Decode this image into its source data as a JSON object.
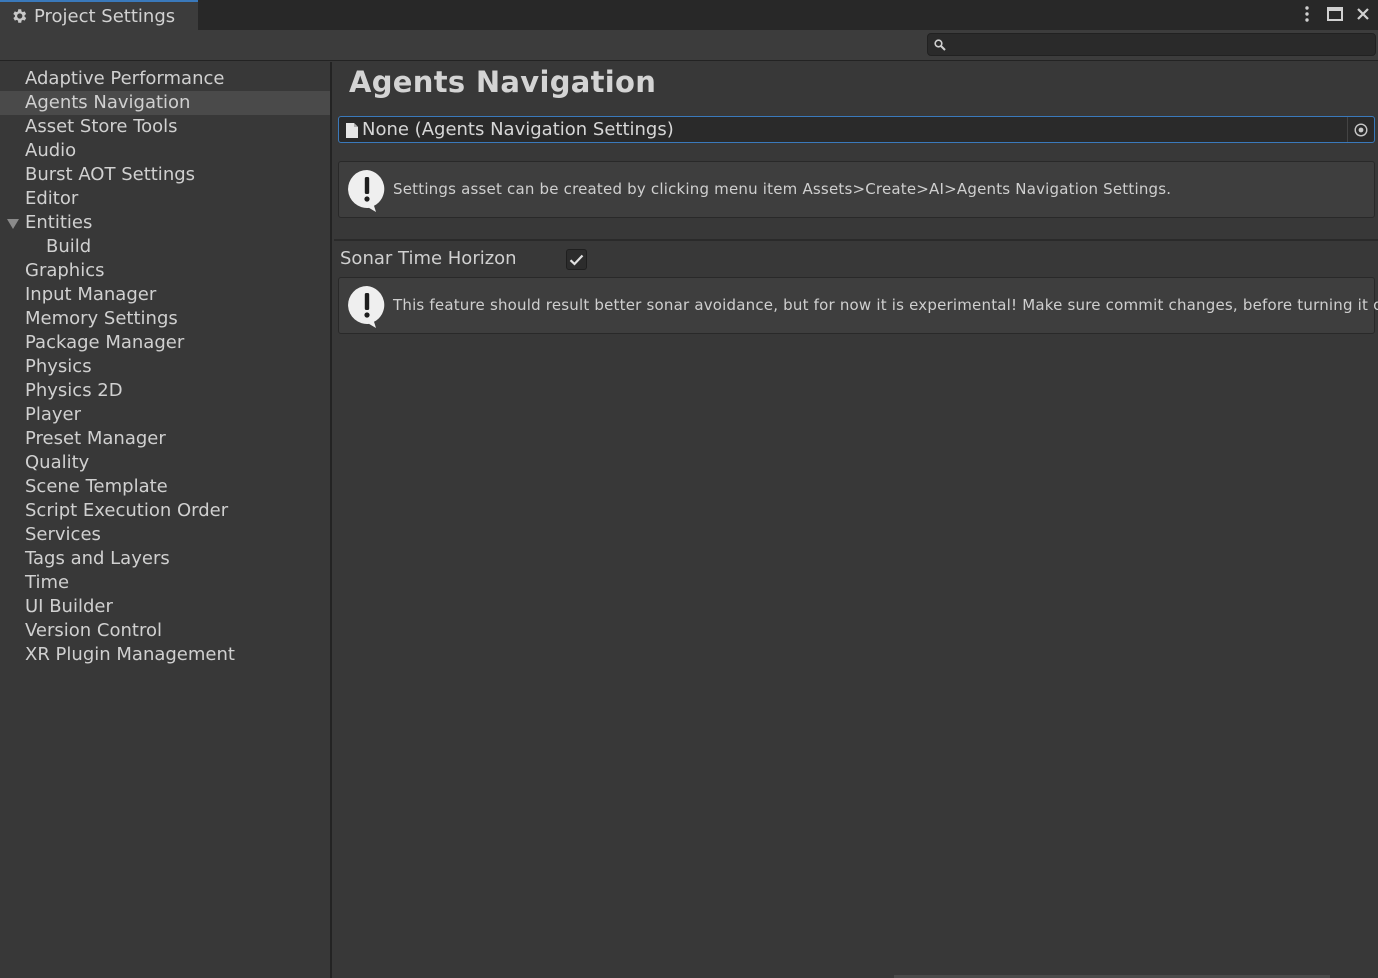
{
  "window": {
    "tab_title": "Project Settings",
    "tab_icon": "gear-icon",
    "controls": [
      "more-options-icon",
      "maximize-icon",
      "close-icon"
    ]
  },
  "search": {
    "icon": "search-icon",
    "value": "",
    "placeholder": ""
  },
  "sidebar": {
    "items": [
      {
        "label": "Adaptive Performance"
      },
      {
        "label": "Agents Navigation",
        "selected": true
      },
      {
        "label": "Asset Store Tools"
      },
      {
        "label": "Audio"
      },
      {
        "label": "Burst AOT Settings"
      },
      {
        "label": "Editor"
      },
      {
        "label": "Entities",
        "expanded": true
      },
      {
        "label": "Build",
        "child": true
      },
      {
        "label": "Graphics"
      },
      {
        "label": "Input Manager"
      },
      {
        "label": "Memory Settings"
      },
      {
        "label": "Package Manager"
      },
      {
        "label": "Physics"
      },
      {
        "label": "Physics 2D"
      },
      {
        "label": "Player"
      },
      {
        "label": "Preset Manager"
      },
      {
        "label": "Quality"
      },
      {
        "label": "Scene Template"
      },
      {
        "label": "Script Execution Order"
      },
      {
        "label": "Services"
      },
      {
        "label": "Tags and Layers"
      },
      {
        "label": "Time"
      },
      {
        "label": "UI Builder"
      },
      {
        "label": "Version Control"
      },
      {
        "label": "XR Plugin Management"
      }
    ]
  },
  "main": {
    "title": "Agents Navigation",
    "object_field": {
      "value": "None (Agents Navigation Settings)"
    },
    "help_settings": "Settings asset can be created by clicking menu item Assets>Create>AI>Agents Navigation Settings.",
    "sonar": {
      "label": "Sonar Time Horizon",
      "checked": true
    },
    "help_sonar": "This feature should result better sonar avoidance, but for now it is experimental! Make sure commit changes, before turning it on."
  },
  "colors": {
    "background": "#383838",
    "titlebar": "#282828",
    "accent": "#3a79bb",
    "selected_row": "#4a4a4a",
    "text": "#d0d0d0"
  }
}
